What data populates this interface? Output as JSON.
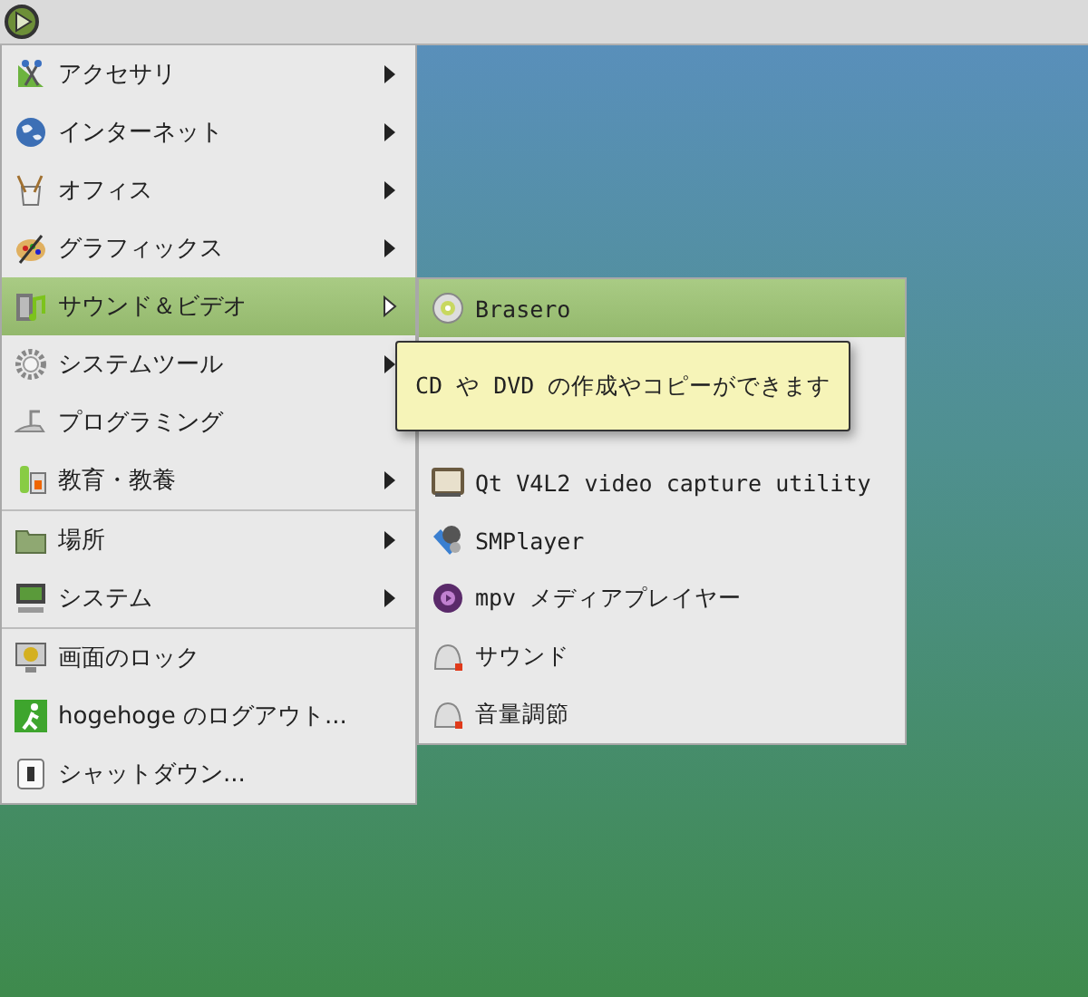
{
  "menu": {
    "sections": [
      [
        {
          "label": "アクセサリ",
          "has_submenu": true,
          "selected": false
        },
        {
          "label": "インターネット",
          "has_submenu": true,
          "selected": false
        },
        {
          "label": "オフィス",
          "has_submenu": true,
          "selected": false
        },
        {
          "label": "グラフィックス",
          "has_submenu": true,
          "selected": false
        },
        {
          "label": "サウンド＆ビデオ",
          "has_submenu": true,
          "selected": true
        },
        {
          "label": "システムツール",
          "has_submenu": true,
          "selected": false
        },
        {
          "label": "プログラミング",
          "has_submenu": false,
          "selected": false
        },
        {
          "label": "教育・教養",
          "has_submenu": true,
          "selected": false
        }
      ],
      [
        {
          "label": "場所",
          "has_submenu": true,
          "selected": false
        },
        {
          "label": "システム",
          "has_submenu": true,
          "selected": false
        }
      ],
      [
        {
          "label": "画面のロック",
          "has_submenu": false,
          "selected": false
        },
        {
          "label": "hogehoge のログアウト...",
          "has_submenu": false,
          "selected": false
        },
        {
          "label": "シャットダウン...",
          "has_submenu": false,
          "selected": false
        }
      ]
    ]
  },
  "submenu": {
    "items": [
      {
        "kind": "item",
        "label": "Brasero",
        "selected": true
      },
      {
        "kind": "covered"
      },
      {
        "kind": "covered"
      },
      {
        "kind": "item",
        "label": "Qt V4L2 video capture utility",
        "selected": false
      },
      {
        "kind": "item",
        "label": "SMPlayer",
        "selected": false
      },
      {
        "kind": "item",
        "label": "mpv メディアプレイヤー",
        "selected": false
      },
      {
        "kind": "item",
        "label": "サウンド",
        "selected": false
      },
      {
        "kind": "item",
        "label": "音量調節",
        "selected": false
      }
    ]
  },
  "tooltip": {
    "text": "CD や DVD の作成やコピーができます"
  }
}
